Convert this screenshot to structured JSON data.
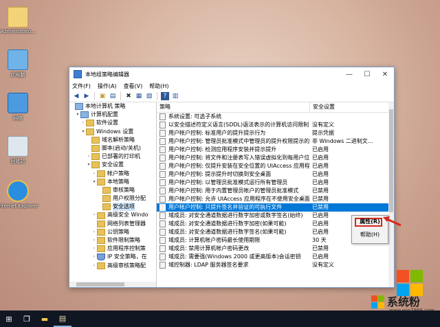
{
  "desktop": {
    "icons": [
      {
        "label": "Administrato..."
      },
      {
        "label": "此电脑"
      },
      {
        "label": "网络"
      },
      {
        "label": "回收站"
      },
      {
        "label": "Internet Explorer"
      }
    ]
  },
  "window": {
    "title": "本地组策略编辑器",
    "menu": [
      "文件(F)",
      "操作(A)",
      "查看(V)",
      "帮助(H)"
    ],
    "controls": {
      "minimize": "—",
      "maximize": "☐",
      "close": "✕"
    }
  },
  "tree": [
    {
      "label": "本地计算机 策略",
      "level": 0,
      "expand": "",
      "icon": "comp"
    },
    {
      "label": "计算机配置",
      "level": 1,
      "expand": "▾",
      "icon": "comp"
    },
    {
      "label": "软件设置",
      "level": 2,
      "expand": "›",
      "icon": "folder"
    },
    {
      "label": "Windows 设置",
      "level": 2,
      "expand": "▾",
      "icon": "folder"
    },
    {
      "label": "域名解析策略",
      "level": 3,
      "expand": "",
      "icon": "folder"
    },
    {
      "label": "脚本(启动/关机)",
      "level": 3,
      "expand": "",
      "icon": "folder"
    },
    {
      "label": "已部署的打印机",
      "level": 3,
      "expand": "›",
      "icon": "folder"
    },
    {
      "label": "安全设置",
      "level": 3,
      "expand": "▾",
      "icon": "folder"
    },
    {
      "label": "帐户策略",
      "level": 4,
      "expand": "›",
      "icon": "folder"
    },
    {
      "label": "本地策略",
      "level": 4,
      "expand": "▾",
      "icon": "folder"
    },
    {
      "label": "审核策略",
      "level": 5,
      "expand": "",
      "icon": "folder"
    },
    {
      "label": "用户权限分配",
      "level": 5,
      "expand": "",
      "icon": "folder"
    },
    {
      "label": "安全选项",
      "level": 5,
      "expand": "",
      "icon": "folder",
      "selected": true
    },
    {
      "label": "高级安全 Windo",
      "level": 4,
      "expand": "›",
      "icon": "folder"
    },
    {
      "label": "网络列表管理器",
      "level": 4,
      "expand": "",
      "icon": "folder"
    },
    {
      "label": "公钥策略",
      "level": 4,
      "expand": "›",
      "icon": "folder"
    },
    {
      "label": "软件限制策略",
      "level": 4,
      "expand": "›",
      "icon": "folder"
    },
    {
      "label": "应用程序控制策",
      "level": 4,
      "expand": "›",
      "icon": "folder"
    },
    {
      "label": "IP 安全策略，在",
      "level": 4,
      "expand": "›",
      "icon": "shield"
    },
    {
      "label": "高级审核策略配",
      "level": 4,
      "expand": "›",
      "icon": "folder"
    }
  ],
  "list": {
    "headers": [
      "策略",
      "安全设置"
    ],
    "rows": [
      {
        "policy": "系统设置: 可选子系统",
        "setting": ""
      },
      {
        "policy": "以安全描述符定义语言(SDDL)语法表示的计算机访问限制",
        "setting": "没有定义"
      },
      {
        "policy": "用户帐户控制: 标准用户的提升提示行为",
        "setting": "提示凭据"
      },
      {
        "policy": "用户帐户控制: 管理员批准模式中管理员的提升权限提示的...",
        "setting": "非 Windows 二进制文..."
      },
      {
        "policy": "用户帐户控制: 检测应用程序安装并提示提升",
        "setting": "已启用"
      },
      {
        "policy": "用户帐户控制: 将文件和注册表写入错误虚拟化到每用户位置",
        "setting": "已启用"
      },
      {
        "policy": "用户帐户控制: 仅提升安装在安全位置的 UIAccess 应用程序",
        "setting": "已启用"
      },
      {
        "policy": "用户帐户控制: 提示提升时切换到安全桌面",
        "setting": "已启用"
      },
      {
        "policy": "用户帐户控制: 以管理员批准模式运行所有管理员",
        "setting": "已启用"
      },
      {
        "policy": "用户帐户控制: 用于内置管理员帐户的管理员批准模式",
        "setting": "已禁用"
      },
      {
        "policy": "用户帐户控制: 允许 UIAccess 应用程序在不使用安全桌面...",
        "setting": "已禁用"
      },
      {
        "policy": "用户帐户控制: 只提升签名并验证的可执行文件",
        "setting": "已禁用",
        "selected": true
      },
      {
        "policy": "域成员: 对安全通道数据进行数字加密或数字签名(始终)",
        "setting": "已启用"
      },
      {
        "policy": "域成员: 对安全通道数据进行数字加密(如果可能)",
        "setting": "已启用"
      },
      {
        "policy": "域成员: 对安全通道数据进行数字签名(如果可能)",
        "setting": "已启用"
      },
      {
        "policy": "域成员: 计算机帐户密码最长使用期限",
        "setting": "30 天"
      },
      {
        "policy": "域成员: 禁用计算机帐户密码更改",
        "setting": "已禁用"
      },
      {
        "policy": "域成员: 需要强(Windows 2000 或更高版本)会话密钥",
        "setting": "已启用"
      },
      {
        "policy": "域控制器: LDAP 服务器签名要求",
        "setting": "没有定义"
      }
    ]
  },
  "context_menu": {
    "properties": "属性(R)",
    "help": "帮助(H)"
  },
  "watermark": {
    "text": "系统粉",
    "url": "www.win7999.com"
  },
  "colors": {
    "selection": "#0078d7",
    "highlight_box": "#d9261c",
    "taskbar": "#101622"
  }
}
